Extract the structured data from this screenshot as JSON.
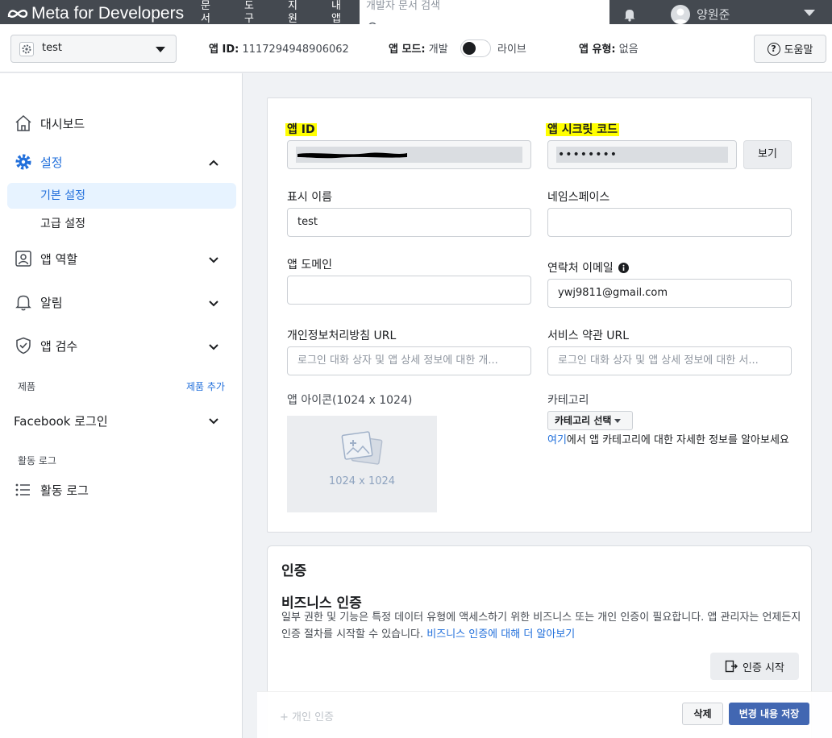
{
  "topbar": {
    "logo": "Meta for Developers",
    "nav": [
      {
        "label": "문서"
      },
      {
        "label": "도구"
      },
      {
        "label": "지원"
      },
      {
        "label": "내앱"
      }
    ],
    "search_placeholder": "개발자 문서 검색",
    "user_name": "양원준"
  },
  "appbar": {
    "app_name": "test",
    "app_id_label": "앱 ID:",
    "app_id_value": "1117294948906062",
    "app_mode_label": "앱 모드:",
    "mode_dev": "개발",
    "mode_live": "라이브",
    "app_type_label": "앱 유형:",
    "app_type_value": "없음",
    "help_label": "도움말"
  },
  "sidebar": {
    "dashboard": "대시보드",
    "settings": "설정",
    "basic_settings": "기본 설정",
    "advanced_settings": "고급 설정",
    "app_roles": "앱 역할",
    "alerts": "알림",
    "app_review": "앱 검수",
    "products_heading": "제품",
    "add_product": "제품 추가",
    "facebook_login": "Facebook 로그인",
    "activity_heading": "활동 로그",
    "activity_log": "활동 로그"
  },
  "basic": {
    "app_id_label": "앱 ID",
    "app_secret_label": "앱 시크릿 코드",
    "app_secret_value": "••••••••",
    "view_button": "보기",
    "display_name_label": "표시 이름",
    "display_name_value": "test",
    "namespace_label": "네임스페이스",
    "namespace_value": "",
    "app_domain_label": "앱 도메인",
    "contact_email_label": "연락처 이메일",
    "contact_email_value": "ywj9811@gmail.com",
    "privacy_url_label": "개인정보처리방침 URL",
    "privacy_url_placeholder": "로그인 대화 상자 및 앱 상세 정보에 대한 개...",
    "tos_url_label": "서비스 약관 URL",
    "tos_url_placeholder": "로그인 대화 상자 및 앱 상세 정보에 대한 서...",
    "app_icon_label": "앱 아이콘(1024 x 1024)",
    "app_icon_size": "1024 x 1024",
    "category_label": "카테고리",
    "category_button": "카테고리 선택",
    "category_help_link": "여기",
    "category_help_text": "에서 앱 카테고리에 대한 자세한 정보를 알아보세요"
  },
  "verification": {
    "title": "인증",
    "business_title": "비즈니스 인증",
    "description": "일부 권한 및 기능은 특정 데이터 유형에 액세스하기 위한 비즈니스 또는 개인 인증이 필요합니다. 앱 관리자는 언제든지 인증 절차를 시작할 수 있습니다. ",
    "learn_more": "비즈니스 인증에 대해 더 알아보기",
    "start_button": "인증 시작"
  },
  "footer": {
    "add_verification": "+ 개인 인증",
    "delete_button": "삭제",
    "save_button": "변경 내용 저장"
  },
  "colors": {
    "topbar": "#444950",
    "link": "#216fdb",
    "active_bg": "#e7f3ff",
    "highlight": "#ffff00",
    "primary_button": "#4267b2"
  }
}
